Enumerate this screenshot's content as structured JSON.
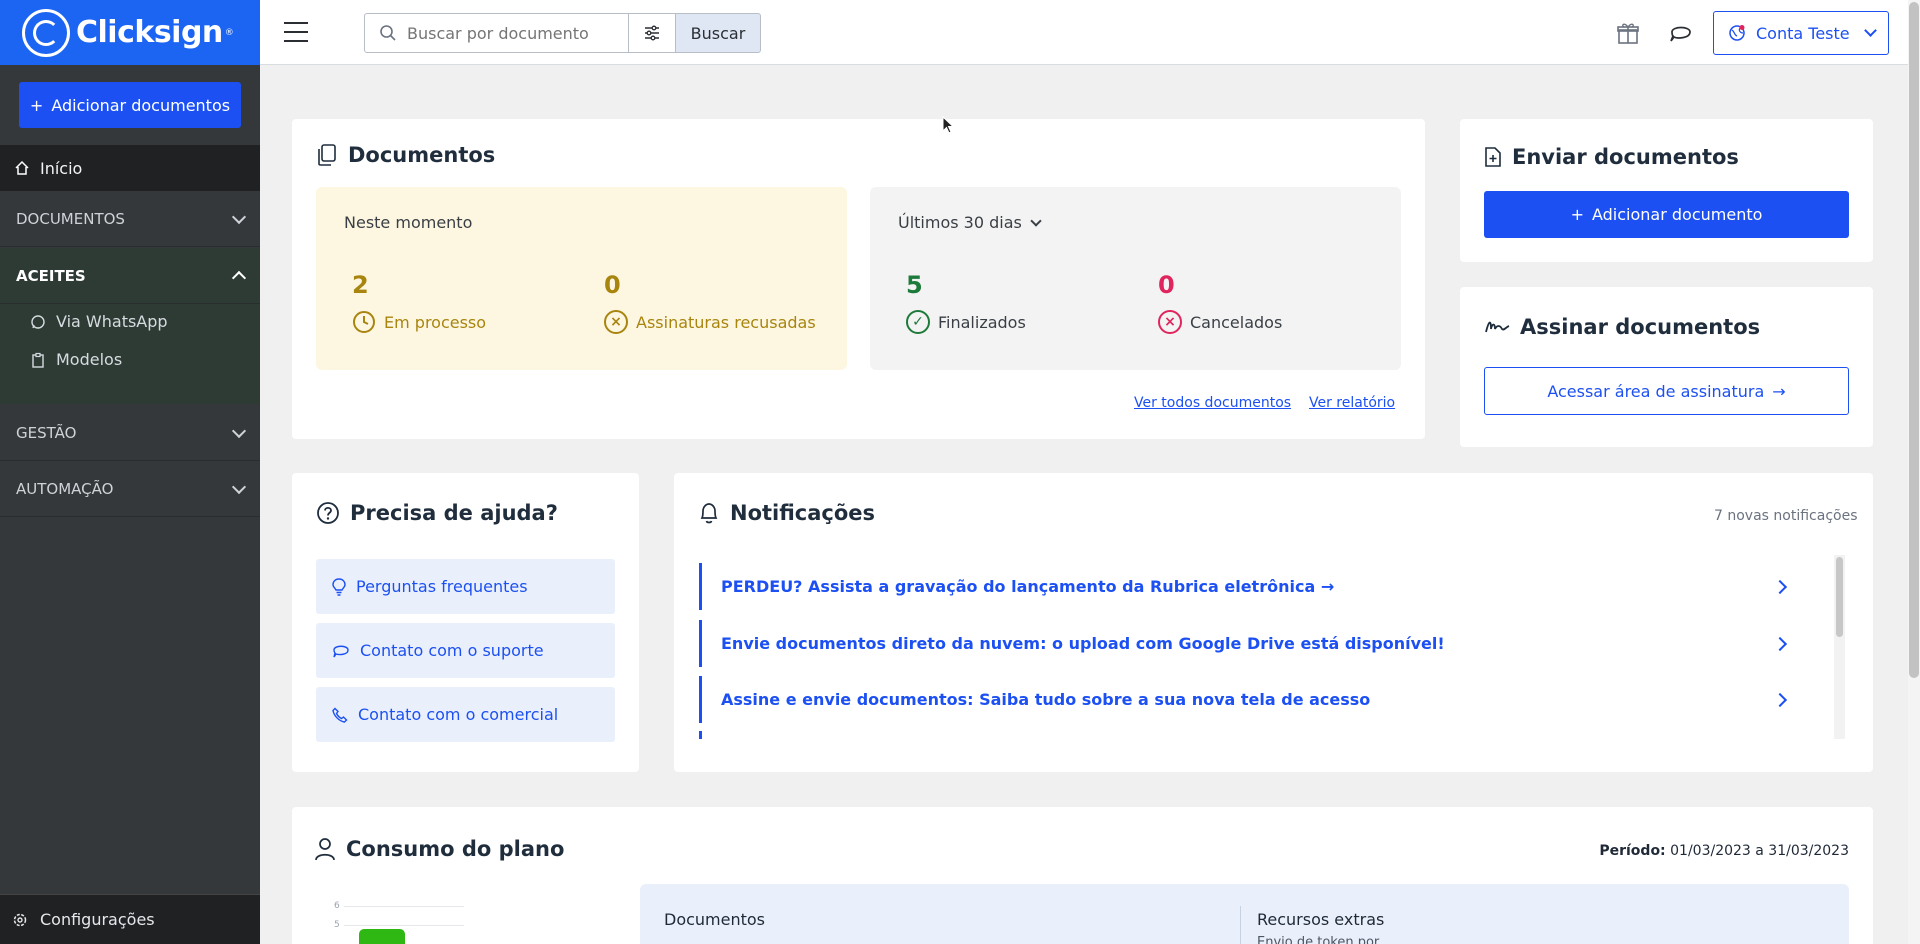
{
  "brand": {
    "name": "Clicksign",
    "reg": "®"
  },
  "sidebar": {
    "add_button": "Adicionar documentos",
    "inicio": "Início",
    "sections": {
      "documentos": "DOCUMENTOS",
      "aceites": "ACEITES",
      "gestao": "GESTÃO",
      "automacao": "AUTOMAÇÃO"
    },
    "aceites_items": [
      "Via WhatsApp",
      "Modelos"
    ],
    "config": "Configurações"
  },
  "topbar": {
    "search_placeholder": "Buscar por documento",
    "search_button": "Buscar",
    "account": "Conta Teste"
  },
  "documentos": {
    "title": "Documentos",
    "now_label": "Neste momento",
    "em_processo_count": "2",
    "em_processo_label": "Em processo",
    "recusadas_count": "0",
    "recusadas_label": "Assinaturas recusadas",
    "period_label": "Últimos 30 dias",
    "finalizados_count": "5",
    "finalizados_label": "Finalizados",
    "cancelados_count": "0",
    "cancelados_label": "Cancelados",
    "link_all": "Ver todos documentos",
    "link_report": "Ver relatório"
  },
  "enviar": {
    "title": "Enviar documentos",
    "button": "Adicionar documento"
  },
  "assinar": {
    "title": "Assinar documentos",
    "button": "Acessar área de assinatura"
  },
  "ajuda": {
    "title": "Precisa de ajuda?",
    "items": [
      "Perguntas frequentes",
      "Contato com o suporte",
      "Contato com o comercial"
    ]
  },
  "notificacoes": {
    "title": "Notificações",
    "count_text": "7 novas notificações",
    "items": [
      "PERDEU? Assista a gravação do lançamento da Rubrica eletrônica →",
      "Envie documentos direto da nuvem: o upload com Google Drive está disponível!",
      "Assine e envie documentos: Saiba tudo sobre a sua nova tela de acesso"
    ]
  },
  "consumo": {
    "title": "Consumo do plano",
    "period_label": "Período:",
    "period_value": "01/03/2023 a 31/03/2023",
    "col_docs": "Documentos",
    "col_extras": "Recursos extras",
    "extras_sub": "Envio de token por",
    "mini_ticks": [
      "6",
      "5"
    ],
    "mini_bar_color": "#2fb814"
  },
  "colors": {
    "primary": "#1c50f2",
    "warning_bg": "#fdf7e1",
    "warning_text": "#a8850f",
    "success": "#1d7a3a",
    "danger": "#e0245e"
  }
}
